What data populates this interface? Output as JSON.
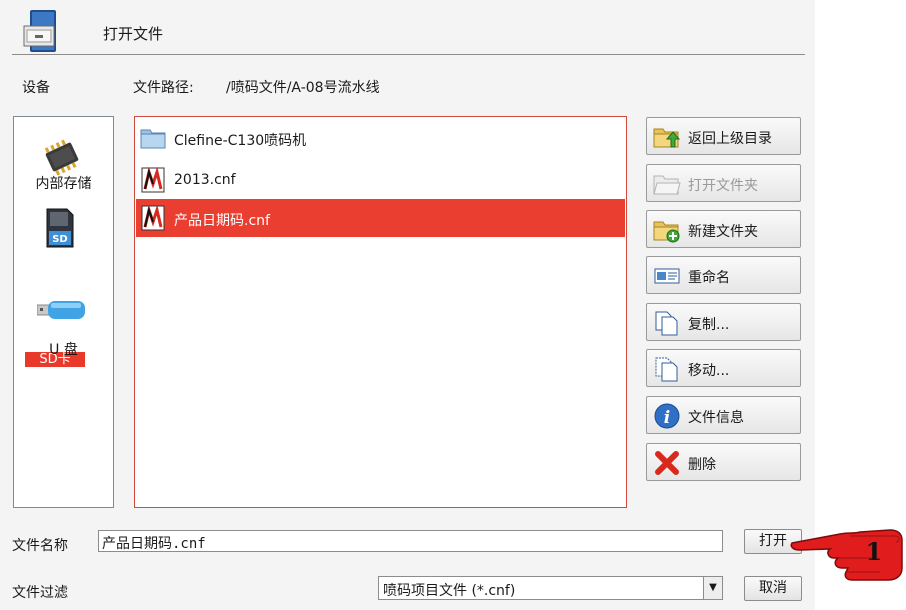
{
  "window": {
    "title": "打开文件"
  },
  "devices": {
    "label": "设备",
    "items": [
      {
        "label": "内部存储",
        "icon": "chip-icon"
      },
      {
        "label": "SD卡",
        "icon": "sd-card-icon",
        "selected": true
      },
      {
        "label": "U 盘",
        "icon": "usb-drive-icon"
      }
    ]
  },
  "path": {
    "label": "文件路径:",
    "value": "/喷码文件/A-08号流水线"
  },
  "files": [
    {
      "name": "Clefine-C130喷码机",
      "type": "folder",
      "icon": "folder-icon"
    },
    {
      "name": "2013.cnf",
      "type": "file",
      "icon": "cnf-file-icon"
    },
    {
      "name": "产品日期码.cnf",
      "type": "file",
      "icon": "cnf-file-icon",
      "selected": true
    }
  ],
  "actions": [
    {
      "label": "返回上级目录",
      "icon": "folder-up-icon",
      "enabled": true
    },
    {
      "label": "打开文件夹",
      "icon": "open-folder-icon",
      "enabled": false
    },
    {
      "label": "新建文件夹",
      "icon": "new-folder-icon",
      "enabled": true
    },
    {
      "label": "重命名",
      "icon": "rename-icon",
      "enabled": true
    },
    {
      "label": "复制...",
      "icon": "copy-icon",
      "enabled": true
    },
    {
      "label": "移动...",
      "icon": "move-icon",
      "enabled": true
    },
    {
      "label": "文件信息",
      "icon": "info-icon",
      "enabled": true
    },
    {
      "label": "删除",
      "icon": "delete-icon",
      "enabled": true
    }
  ],
  "filename": {
    "label": "文件名称",
    "value": "产品日期码.cnf",
    "open_label": "打开"
  },
  "filter": {
    "label": "文件过滤",
    "value": "喷码项目文件 (*.cnf)",
    "cancel_label": "取消"
  },
  "callout": {
    "number": "1"
  },
  "colors": {
    "selection": "#ea3e30",
    "panel_border": "#d14a3e",
    "background": "#f4f4f4"
  }
}
